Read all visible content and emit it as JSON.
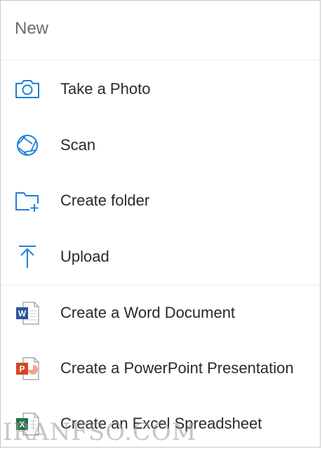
{
  "header": {
    "title": "New"
  },
  "menu": {
    "take_photo": "Take a Photo",
    "scan": "Scan",
    "create_folder": "Create folder",
    "upload": "Upload",
    "create_word": "Create a Word Document",
    "create_powerpoint": "Create a PowerPoint Presentation",
    "create_excel": "Create an Excel Spreadsheet"
  },
  "icons": {
    "take_photo": "camera-icon",
    "scan": "aperture-icon",
    "create_folder": "folder-add-icon",
    "upload": "upload-icon",
    "create_word": "word-document-icon",
    "create_powerpoint": "powerpoint-document-icon",
    "create_excel": "excel-document-icon"
  },
  "colors": {
    "accent_blue": "#1e7fd6",
    "word_blue": "#2b579a",
    "powerpoint_red": "#d24726",
    "excel_green": "#217346"
  },
  "watermark": "IRANFSO.COM"
}
